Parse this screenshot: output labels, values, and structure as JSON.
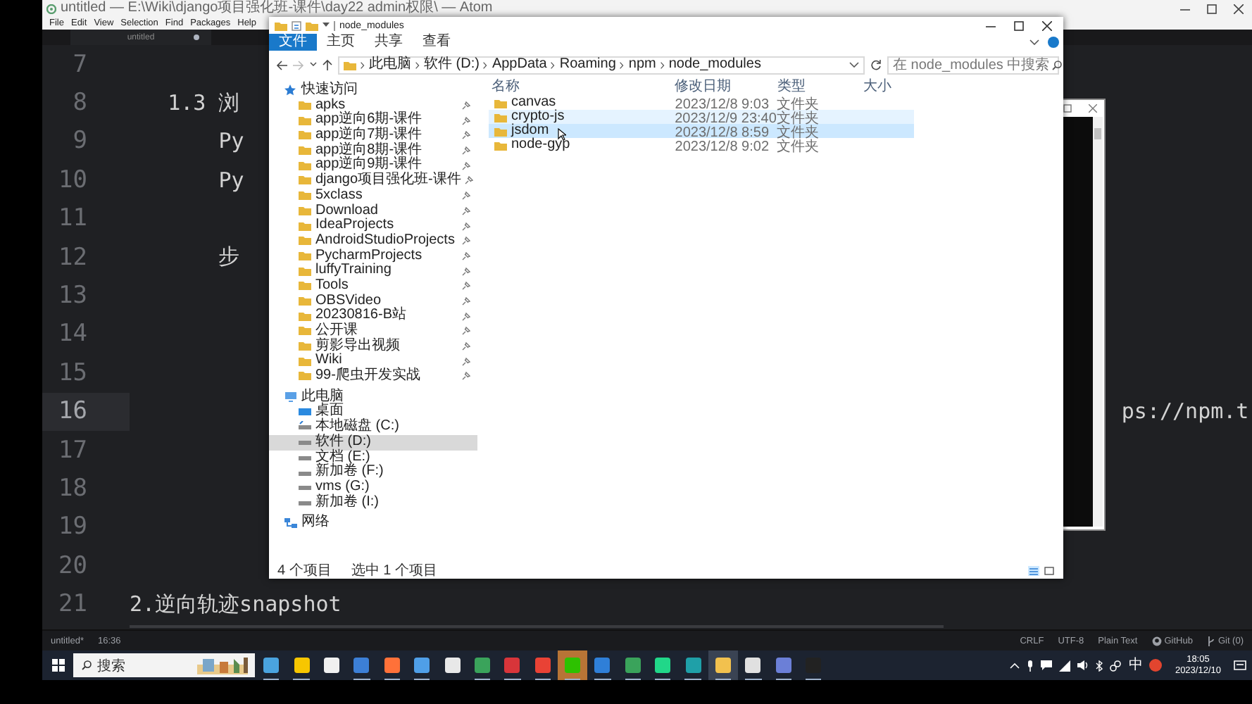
{
  "atom": {
    "title": "untitled — E:\\Wiki\\django项目强化班-课件\\day22 admin权限\\ — Atom",
    "menu": [
      "File",
      "Edit",
      "View",
      "Selection",
      "Find",
      "Packages",
      "Help"
    ],
    "tab": {
      "label": "untitled",
      "modified": true
    },
    "lines": [
      {
        "number": "7",
        "current": false
      },
      {
        "number": "8",
        "text": "   1.3 浏",
        "current": false
      },
      {
        "number": "9",
        "text": "       Py",
        "current": false
      },
      {
        "number": "10",
        "text": "       Py",
        "current": false
      },
      {
        "number": "11",
        "current": false
      },
      {
        "number": "12",
        "text": "       步",
        "current": false
      },
      {
        "number": "13",
        "current": false
      },
      {
        "number": "14",
        "current": false
      },
      {
        "number": "15",
        "current": false
      },
      {
        "number": "16",
        "text": "                                                                              ps://npm.t",
        "current": true
      },
      {
        "number": "17",
        "current": false
      },
      {
        "number": "18",
        "current": false
      },
      {
        "number": "19",
        "current": false
      },
      {
        "number": "20",
        "current": false
      },
      {
        "number": "21",
        "text": "2.逆向轨迹snapshot",
        "current": false
      }
    ],
    "status_bar": {
      "file": "untitled*",
      "cursor": "16:36",
      "items": [
        {
          "label": "CRLF",
          "kind": "text"
        },
        {
          "label": "UTF-8",
          "kind": "text"
        },
        {
          "label": "Plain Text",
          "kind": "text"
        },
        {
          "label": "GitHub",
          "kind": "github"
        },
        {
          "label": "Git (0)",
          "kind": "git"
        }
      ]
    }
  },
  "explorer": {
    "title": "node_modules",
    "ribbon_tabs": [
      {
        "label": "文件",
        "selected": true
      },
      {
        "label": "主页",
        "selected": false
      },
      {
        "label": "共享",
        "selected": false
      },
      {
        "label": "查看",
        "selected": false
      }
    ],
    "breadcrumb": [
      "此电脑",
      "软件 (D:)",
      "AppData",
      "Roaming",
      "npm",
      "node_modules"
    ],
    "search": {
      "placeholder": "在 node_modules 中搜索"
    },
    "sidebar": [
      {
        "label": "快速访问",
        "kind": "quick-access",
        "selected": false,
        "children": [
          {
            "label": "apks",
            "kind": "folder",
            "pinned": true,
            "selected": false
          },
          {
            "label": "app逆向6期-课件",
            "kind": "folder",
            "pinned": true,
            "selected": false
          },
          {
            "label": "app逆向7期-课件",
            "kind": "folder",
            "pinned": true,
            "selected": false
          },
          {
            "label": "app逆向8期-课件",
            "kind": "folder",
            "pinned": true,
            "selected": false
          },
          {
            "label": "app逆向9期-课件",
            "kind": "folder",
            "pinned": true,
            "selected": false
          },
          {
            "label": "django项目强化班-课件",
            "kind": "folder",
            "pinned": true,
            "selected": false
          },
          {
            "label": "5xclass",
            "kind": "folder",
            "pinned": true,
            "selected": false
          },
          {
            "label": "Download",
            "kind": "folder",
            "pinned": true,
            "selected": false
          },
          {
            "label": "IdeaProjects",
            "kind": "folder",
            "pinned": true,
            "selected": false
          },
          {
            "label": "AndroidStudioProjects",
            "kind": "folder",
            "pinned": true,
            "selected": false
          },
          {
            "label": "PycharmProjects",
            "kind": "folder",
            "pinned": true,
            "selected": false
          },
          {
            "label": "luffyTraining",
            "kind": "folder",
            "pinned": true,
            "selected": false
          },
          {
            "label": "Tools",
            "kind": "folder",
            "pinned": true,
            "selected": false
          },
          {
            "label": "OBSVideo",
            "kind": "folder",
            "pinned": true,
            "selected": false
          },
          {
            "label": "20230816-B站",
            "kind": "folder",
            "pinned": true,
            "selected": false
          },
          {
            "label": "公开课",
            "kind": "folder",
            "pinned": true,
            "selected": false
          },
          {
            "label": "剪影导出视频",
            "kind": "folder",
            "pinned": true,
            "selected": false
          },
          {
            "label": "Wiki",
            "kind": "folder",
            "pinned": true,
            "selected": false
          },
          {
            "label": "99-爬虫开发实战",
            "kind": "folder",
            "pinned": true,
            "selected": false
          }
        ]
      },
      {
        "label": "此电脑",
        "kind": "pc",
        "selected": false,
        "children": [
          {
            "label": "桌面",
            "kind": "desktop",
            "selected": false
          },
          {
            "label": "本地磁盘 (C:)",
            "kind": "system-drive",
            "selected": false
          },
          {
            "label": "软件 (D:)",
            "kind": "drive",
            "selected": true
          },
          {
            "label": "文档 (E:)",
            "kind": "drive",
            "selected": false
          },
          {
            "label": "新加卷 (F:)",
            "kind": "drive",
            "selected": false
          },
          {
            "label": "vms (G:)",
            "kind": "drive",
            "selected": false
          },
          {
            "label": "新加卷 (I:)",
            "kind": "drive",
            "selected": false
          }
        ]
      },
      {
        "label": "网络",
        "kind": "network",
        "selected": false
      }
    ],
    "columns": [
      "名称",
      "修改日期",
      "类型",
      "大小"
    ],
    "rows": [
      {
        "name": "canvas",
        "modified": "2023/12/8 9:03",
        "type": "文件夹",
        "selected": false,
        "hovered": false
      },
      {
        "name": "crypto-js",
        "modified": "2023/12/9 23:40",
        "type": "文件夹",
        "selected": false,
        "hovered": true
      },
      {
        "name": "jsdom",
        "modified": "2023/12/8 8:59",
        "type": "文件夹",
        "selected": true,
        "hovered": false
      },
      {
        "name": "node-gyp",
        "modified": "2023/12/8 9:02",
        "type": "文件夹",
        "selected": false,
        "hovered": false
      }
    ],
    "status_bar": {
      "count": "4 个项目",
      "selection": "选中 1 个项目"
    }
  },
  "taskbar": {
    "search": {
      "placeholder": "搜索"
    },
    "apps": [
      {
        "color": "#4aa3df",
        "running": true,
        "active": false,
        "flashing": false
      },
      {
        "color": "#f7c600",
        "running": true,
        "active": false,
        "flashing": false
      },
      {
        "color": "#f0f0f0",
        "running": false,
        "active": false,
        "flashing": false
      },
      {
        "color": "#3c7fd6",
        "running": true,
        "active": false,
        "flashing": false
      },
      {
        "color": "#ff7139",
        "running": true,
        "active": false,
        "flashing": false
      },
      {
        "color": "#4f9fe8",
        "running": true,
        "active": false,
        "flashing": false
      },
      {
        "color": "#e8e8e8",
        "running": false,
        "active": false,
        "flashing": false
      },
      {
        "color": "#3aa35b",
        "running": true,
        "active": false,
        "flashing": false
      },
      {
        "color": "#d8353a",
        "running": true,
        "active": false,
        "flashing": false
      },
      {
        "color": "#e94235",
        "running": true,
        "active": false,
        "flashing": false
      },
      {
        "color": "#2dc100",
        "running": true,
        "active": false,
        "flashing": true
      },
      {
        "color": "#2f7fd8",
        "running": true,
        "active": false,
        "flashing": false
      },
      {
        "color": "#3aa35b",
        "running": true,
        "active": false,
        "flashing": false
      },
      {
        "color": "#21d789",
        "running": true,
        "active": false,
        "flashing": false
      },
      {
        "color": "#1fa0a8",
        "running": true,
        "active": false,
        "flashing": false
      },
      {
        "color": "#f2c14e",
        "running": true,
        "active": true,
        "flashing": false
      },
      {
        "color": "#e0e0e0",
        "running": true,
        "active": false,
        "flashing": false
      },
      {
        "color": "#6b7fd7",
        "running": true,
        "active": false,
        "flashing": false
      },
      {
        "color": "#222222",
        "running": true,
        "active": false,
        "flashing": false
      }
    ],
    "tray": {
      "ime": "中",
      "time": "18:05",
      "date": "2023/12/10"
    }
  }
}
